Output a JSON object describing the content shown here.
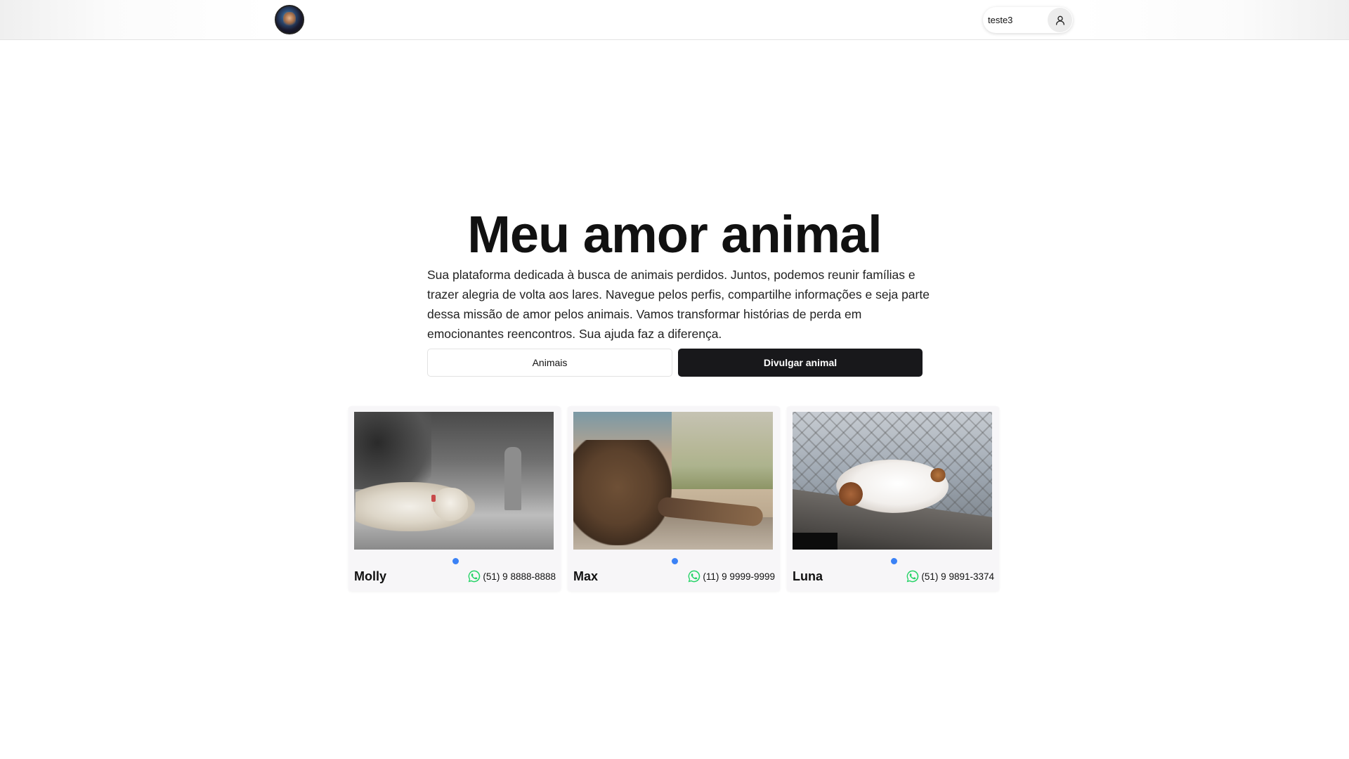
{
  "header": {
    "username": "teste3",
    "logo_icon": "pet-logo-icon",
    "user_icon": "user-icon"
  },
  "hero": {
    "title": "Meu amor animal",
    "description": "Sua plataforma dedicada à busca de animais perdidos. Juntos, podemos reunir famílias e trazer alegria de volta aos lares. Navegue pelos perfis, compartilhe informações e seja parte dessa missão de amor pelos animais. Vamos transformar histórias de perda em emocionantes reencontros. Sua ajuda faz a diferença.",
    "btn_animais": "Animais",
    "btn_divulgar": "Divulgar animal"
  },
  "colors": {
    "primary_button": "#18181b",
    "carousel_dot": "#3b82f6",
    "whatsapp": "#25d366"
  },
  "cards": [
    {
      "name": "Molly",
      "phone": "(51) 9 8888-8888",
      "icon": "whatsapp-icon"
    },
    {
      "name": "Max",
      "phone": "(11) 9 9999-9999",
      "icon": "whatsapp-icon"
    },
    {
      "name": "Luna",
      "phone": "(51) 9 9891-3374",
      "icon": "whatsapp-icon"
    }
  ]
}
